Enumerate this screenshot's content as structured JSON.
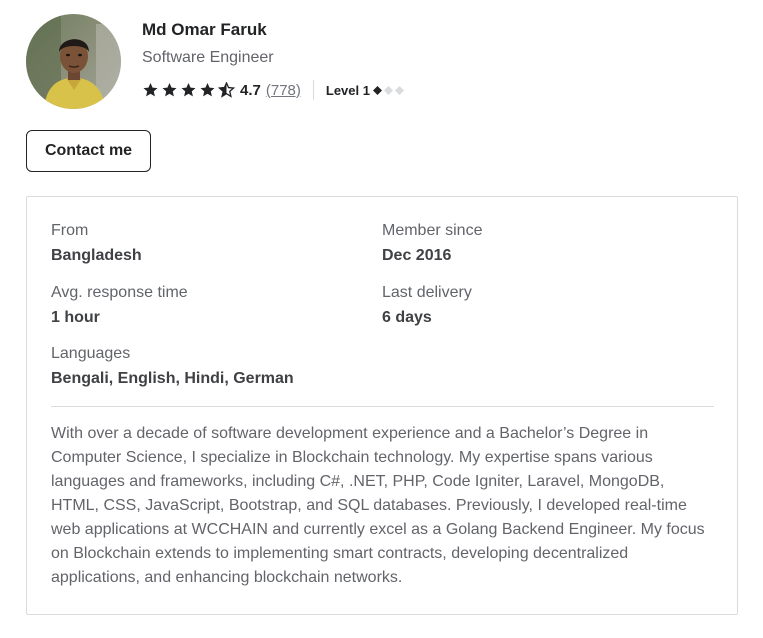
{
  "profile": {
    "name": "Md Omar Faruk",
    "title": "Software Engineer",
    "rating": {
      "score": "4.7",
      "count": "(778)",
      "stars_full": 4,
      "stars_half": 1
    },
    "level": {
      "label": "Level 1",
      "filled": 1,
      "total": 3
    }
  },
  "actions": {
    "contact_label": "Contact me"
  },
  "stats": {
    "from_label": "From",
    "from_value": "Bangladesh",
    "member_since_label": "Member since",
    "member_since_value": "Dec 2016",
    "response_label": "Avg. response time",
    "response_value": "1 hour",
    "last_delivery_label": "Last delivery",
    "last_delivery_value": "6 days",
    "languages_label": "Languages",
    "languages_value": "Bengali, English, Hindi, German"
  },
  "description": "With over a decade of software development experience and a Bachelor’s Degree in Computer Science, I specialize in Blockchain technology. My expertise spans various languages and frameworks, including C#, .NET, PHP, Code Igniter, Laravel, MongoDB, HTML, CSS, JavaScript, Bootstrap, and SQL databases. Previously, I developed real-time web applications at WCCHAIN and currently excel as a Golang Backend Engineer. My focus on Blockchain extends to implementing smart contracts, developing decentralized applications, and enhancing blockchain networks.",
  "icons": {
    "star": "star-icon",
    "half_star": "star-half-icon",
    "level": "diamond-icon"
  },
  "colors": {
    "text_dark": "#222325",
    "text_body": "#404145",
    "text_muted": "#62646a",
    "border": "#dadbdd",
    "star": "#222325",
    "diamond_empty": "#dadbdd"
  }
}
